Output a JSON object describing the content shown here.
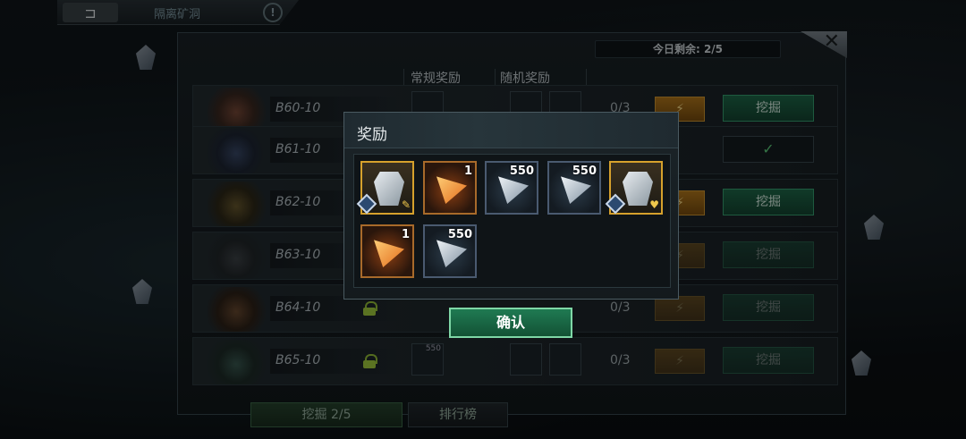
{
  "topbar": {
    "back_label": "⊐",
    "title": "隔离矿洞",
    "info_label": "!"
  },
  "panel": {
    "remaining_text": "今日剩余: 2/5",
    "close_label": "✕",
    "col_regular": "常规奖励",
    "col_random": "随机奖励",
    "rows": [
      {
        "name": "B60-10",
        "count": "0/3",
        "boost": "⚡",
        "action": "挖掘",
        "state": "dig"
      },
      {
        "name": "B61-10",
        "count": "",
        "boost": "",
        "action": "✓",
        "state": "done"
      },
      {
        "name": "B62-10",
        "count": "",
        "boost": "⚡",
        "action": "挖掘",
        "state": "dig"
      },
      {
        "name": "B63-10",
        "count": "",
        "boost": "⚡",
        "action": "挖掘",
        "state": "dig"
      },
      {
        "name": "B64-10",
        "count": "0/3",
        "boost": "⚡",
        "action": "挖掘",
        "state": "locked"
      },
      {
        "name": "B65-10",
        "count": "0/3",
        "boost": "⚡",
        "action": "挖掘",
        "state": "locked",
        "slot_qty": "550"
      }
    ],
    "tabs": {
      "dig": "挖掘 2/5",
      "rank": "排行榜"
    }
  },
  "dialog": {
    "title": "奖励",
    "items": [
      {
        "kind": "armor",
        "frame": "gold",
        "qty": "",
        "mark": "✎"
      },
      {
        "kind": "tri-orange",
        "frame": "orange",
        "qty": "1"
      },
      {
        "kind": "tri-blue",
        "frame": "blue",
        "qty": "550"
      },
      {
        "kind": "tri-blue",
        "frame": "blue",
        "qty": "550"
      },
      {
        "kind": "armor",
        "frame": "gold",
        "qty": "",
        "mark": "♥"
      },
      {
        "kind": "tri-orange",
        "frame": "orange",
        "qty": "1"
      },
      {
        "kind": "tri-blue",
        "frame": "blue",
        "qty": "550"
      }
    ],
    "confirm_label": "确认"
  }
}
